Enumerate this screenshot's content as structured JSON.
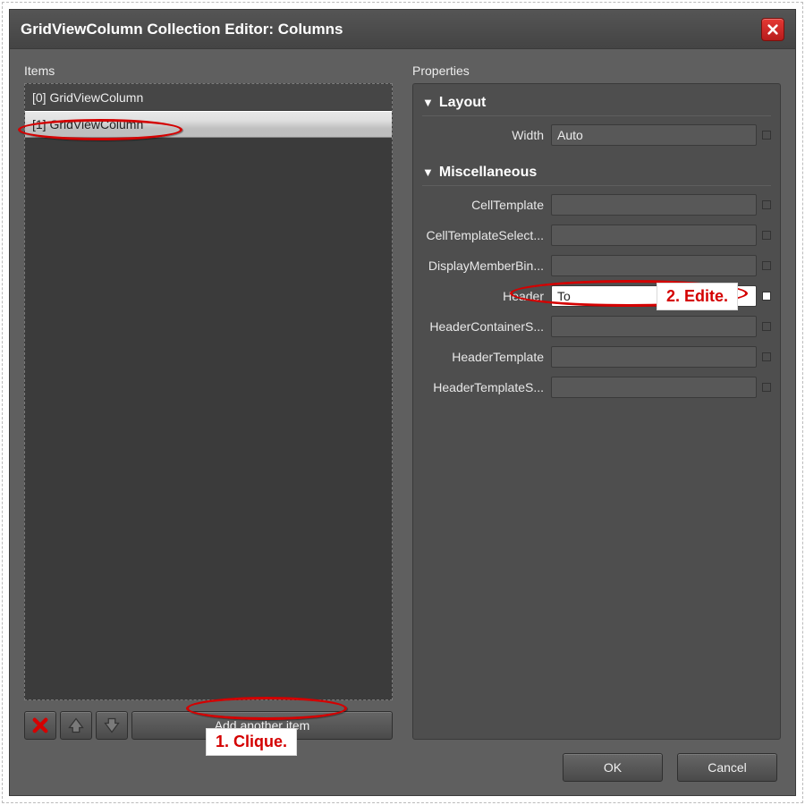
{
  "title": "GridViewColumn Collection Editor: Columns",
  "itemsLabel": "Items",
  "propertiesLabel": "Properties",
  "items": [
    {
      "label": "[0] GridViewColumn",
      "selected": false
    },
    {
      "label": "[1] GridViewColumn",
      "selected": true
    }
  ],
  "addAnother": "Add another item",
  "sections": {
    "layout": {
      "title": "Layout",
      "width": {
        "label": "Width",
        "value": "Auto"
      }
    },
    "misc": {
      "title": "Miscellaneous",
      "cellTemplate": {
        "label": "CellTemplate",
        "value": ""
      },
      "cellTemplateSelector": {
        "label": "CellTemplateSelect...",
        "value": ""
      },
      "displayMemberBinding": {
        "label": "DisplayMemberBin...",
        "value": ""
      },
      "header": {
        "label": "Header",
        "value": "To"
      },
      "headerContainerStyle": {
        "label": "HeaderContainerS...",
        "value": ""
      },
      "headerTemplate": {
        "label": "HeaderTemplate",
        "value": ""
      },
      "headerTemplateSelector": {
        "label": "HeaderTemplateS...",
        "value": ""
      }
    }
  },
  "buttons": {
    "ok": "OK",
    "cancel": "Cancel"
  },
  "annotations": {
    "step1": "1. Clique.",
    "step2": "2. Edite."
  }
}
